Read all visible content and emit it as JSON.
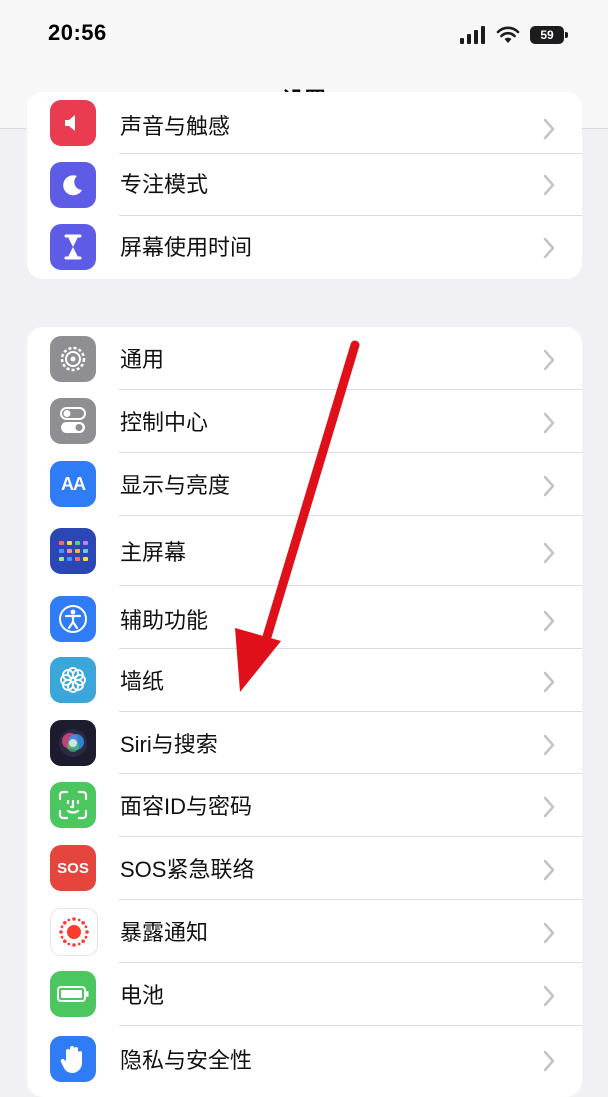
{
  "status": {
    "time": "20:56",
    "battery": "59"
  },
  "header": {
    "title": "设置"
  },
  "group1": [
    {
      "label": "声音与触感",
      "icon": "sound-icon",
      "color": "#eb3b50"
    },
    {
      "label": "专注模式",
      "icon": "moon-icon",
      "color": "#5e5ce6"
    },
    {
      "label": "屏幕使用时间",
      "icon": "hourglass-icon",
      "color": "#5e5ce6"
    }
  ],
  "group2": [
    {
      "label": "通用",
      "icon": "gear-icon",
      "color": "#8e8e93"
    },
    {
      "label": "控制中心",
      "icon": "toggles-icon",
      "color": "#8e8e93"
    },
    {
      "label": "显示与亮度",
      "icon": "text-size-icon",
      "color": "#2f7cf6"
    },
    {
      "label": "主屏幕",
      "icon": "home-grid-icon",
      "color": "#2b47b6"
    },
    {
      "label": "辅助功能",
      "icon": "accessibility-icon",
      "color": "#2f7cf6"
    },
    {
      "label": "墙纸",
      "icon": "flower-icon",
      "color": "#3aa6d9"
    },
    {
      "label": "Siri与搜索",
      "icon": "siri-icon",
      "color": "#1c1c2e"
    },
    {
      "label": "面容ID与密码",
      "icon": "face-id-icon",
      "color": "#4cc75f"
    },
    {
      "label": "SOS紧急联络",
      "icon": "sos-icon",
      "color": "#e5453c"
    },
    {
      "label": "暴露通知",
      "icon": "exposure-icon",
      "color": "#ffffff"
    },
    {
      "label": "电池",
      "icon": "battery-icon",
      "color": "#4cc75f"
    },
    {
      "label": "隐私与安全性",
      "icon": "hand-icon",
      "color": "#2f7cf6"
    }
  ],
  "sos_text": "SOS",
  "aa_text": "AA",
  "annotation": {
    "color": "#e0101a"
  }
}
